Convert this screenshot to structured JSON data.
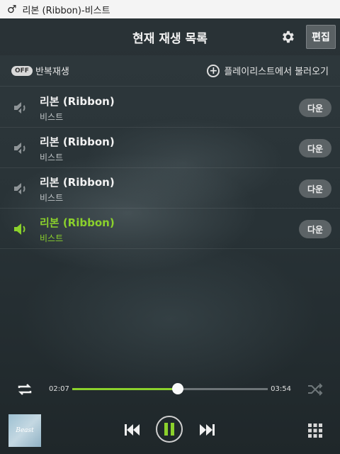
{
  "status_bar": {
    "now_playing": "리본 (Ribbon)-비스트",
    "note_icon": "music-note-icon"
  },
  "header": {
    "title": "현재 재생 목록",
    "settings_icon": "gear-icon",
    "edit_label": "편집"
  },
  "options": {
    "repeat_badge": "OFF",
    "repeat_label": "반복재생",
    "load_label": "플레이리스트에서 불러오기",
    "load_icon": "plus-circle-icon"
  },
  "playlist": [
    {
      "title": "리본 (Ribbon)",
      "artist": "비스트",
      "download_label": "다운",
      "active": false,
      "icon": "speaker-muted-icon"
    },
    {
      "title": "리본 (Ribbon)",
      "artist": "비스트",
      "download_label": "다운",
      "active": false,
      "icon": "speaker-muted-icon"
    },
    {
      "title": "리본 (Ribbon)",
      "artist": "비스트",
      "download_label": "다운",
      "active": false,
      "icon": "speaker-muted-icon"
    },
    {
      "title": "리본 (Ribbon)",
      "artist": "비스트",
      "download_label": "다운",
      "active": true,
      "icon": "speaker-playing-icon"
    }
  ],
  "player": {
    "elapsed": "02:07",
    "total": "03:54",
    "progress_fraction": 0.54,
    "album_art_text": "Beast",
    "repeat_icon": "repeat-icon",
    "shuffle_icon": "shuffle-icon",
    "prev_icon": "previous-track-icon",
    "pause_icon": "pause-icon",
    "next_icon": "next-track-icon",
    "menu_icon": "grid-menu-icon"
  },
  "colors": {
    "accent": "#8bd12c",
    "background": "#2a3438"
  }
}
